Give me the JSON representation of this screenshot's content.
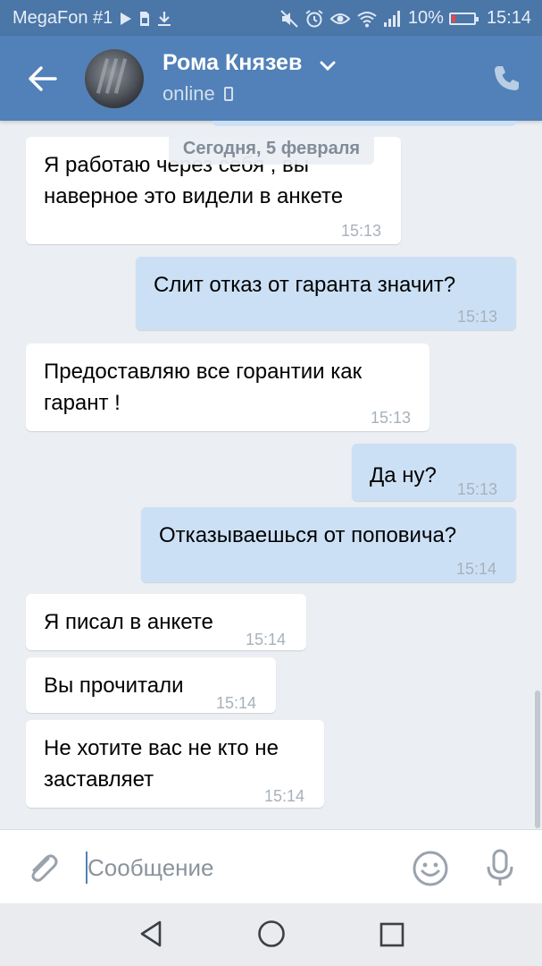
{
  "status_bar": {
    "carrier": "MegaFon #1",
    "battery": "10%",
    "time": "15:14",
    "icons": [
      "play-icon",
      "sim-icon",
      "download-icon",
      "mute-icon",
      "alarm-icon",
      "eye-icon",
      "wifi-icon",
      "signal-icon",
      "battery-icon"
    ]
  },
  "header": {
    "name": "Рома Князев",
    "status": "online",
    "accent": "#5181b8"
  },
  "chat": {
    "date_separator": "Сегодня, 5 февраля",
    "messages": [
      {
        "dir": "in",
        "text": "Я работаю через себя , вы\nнаверное это видели в анкете",
        "time": "15:13"
      },
      {
        "dir": "out",
        "text": "Слит отказ от гаранта значит?",
        "time": "15:13"
      },
      {
        "dir": "in",
        "text": "Предоставляю все горантии как\nгарант !",
        "time": "15:13"
      },
      {
        "dir": "out",
        "text": "Да ну?",
        "time": "15:13"
      },
      {
        "dir": "out",
        "text": "Отказываешься от поповича?",
        "time": "15:14"
      },
      {
        "dir": "in",
        "text": "Я писал в анкете",
        "time": "15:14"
      },
      {
        "dir": "in",
        "text": "Вы прочитали",
        "time": "15:14"
      },
      {
        "dir": "in",
        "text": "Не хотите вас не кто не\nзаставляет",
        "time": "15:14"
      }
    ],
    "colors": {
      "incoming": "#ffffff",
      "outgoing": "#cce0f5"
    }
  },
  "composer": {
    "placeholder": "Сообщение",
    "value": ""
  },
  "navbar": {
    "buttons": [
      "back-triangle-icon",
      "home-circle-icon",
      "recent-square-icon"
    ]
  }
}
